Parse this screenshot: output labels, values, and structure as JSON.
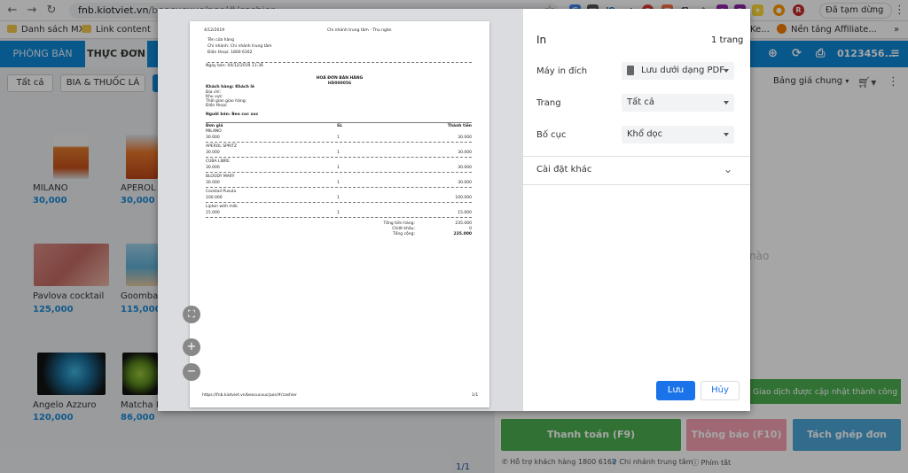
{
  "browser": {
    "url_host": "fnb.kiotviet.vn",
    "url_path": "/beocucxuc/pos/#/cashier",
    "pause_label": "Đã tạm dừng",
    "bookmarks": [
      "Danh sách MXH",
      "Link content",
      "Ke...",
      "Nền tảng Affiliate..."
    ]
  },
  "app": {
    "tabs": [
      "PHÒNG BÀN",
      "THỰC ĐƠN"
    ],
    "phone": "0123456...",
    "categories": [
      "Tất cả",
      "BIA & THUỐC LÁ"
    ],
    "price_list": "Bảng giá chung",
    "products": [
      {
        "name": "MILANO",
        "price": "30,000"
      },
      {
        "name": "APEROL S",
        "price": "30,000"
      },
      {
        "name": "Pavlova cocktail",
        "price": "125,000"
      },
      {
        "name": "Goombay",
        "price": "115,000"
      },
      {
        "name": "Angelo Azzuro",
        "price": "120,000"
      },
      {
        "name": "Matcha Ha",
        "price": "86,000"
      }
    ],
    "empty_hint": "nào",
    "toast": "Giao dịch được cập nhật thành công",
    "buttons": {
      "pay": "Thanh toán (F9)",
      "notify": "Thông báo (F10)",
      "split": "Tách ghép đơn"
    },
    "footer": {
      "support": "Hỗ trợ khách hàng 1800 6162",
      "branch": "Chi nhánh trung tâm",
      "shortcuts": "Phím tắt"
    },
    "pager": "1/1",
    "colors": {
      "brand": "#0e87d6",
      "pay": "#4caf50",
      "notify": "#f4a0b0",
      "split": "#4ca6d9",
      "price": "#1d8ad6"
    }
  },
  "print": {
    "title": "In",
    "pages": "1 trang",
    "destination_label": "Máy in đích",
    "destination_value": "Lưu dưới dạng PDF",
    "pages_label": "Trang",
    "pages_value": "Tất cả",
    "layout_label": "Bố cục",
    "layout_value": "Khổ dọc",
    "more_label": "Cài đặt khác",
    "save": "Lưu",
    "cancel": "Hủy"
  },
  "receipt": {
    "date": "4/12/2019",
    "header_center": "Chi nhánh trung tâm - Thu ngân",
    "store_name": "Tên cửa hàng",
    "branch": "Chi nhánh: Chi nhánh trung tâm",
    "phone": "Điện thoại: 1800 6162",
    "sale_date": "Ngày bán: 04/12/2019 11:36",
    "title": "HOÁ ĐƠN BÁN HÀNG",
    "code": "HD000056",
    "customer": "Khách hàng: Khách lẻ",
    "address": "Địa chỉ:",
    "area": "Khu vực:",
    "delivery": "Thời gian giao hàng:",
    "cust_phone": "Điện thoại:",
    "seller": "Người bán: Beo cuc xuc",
    "col_price": "Đơn giá",
    "col_qty": "SL",
    "col_total": "Thành tiền",
    "items": [
      {
        "name": "MILANO",
        "price": "30.000",
        "qty": "1",
        "total": "30.000"
      },
      {
        "name": "APEROL SPRITZ",
        "price": "30.000",
        "qty": "1",
        "total": "30.000"
      },
      {
        "name": "CUBA LIBRE",
        "price": "30.000",
        "qty": "1",
        "total": "30.000"
      },
      {
        "name": "BLOODY MARY",
        "price": "30.000",
        "qty": "1",
        "total": "30.000"
      },
      {
        "name": "Cocktail Pusula",
        "price": "100.000",
        "qty": "1",
        "total": "100.000"
      },
      {
        "name": "Lipton with milk",
        "price": "15.000",
        "qty": "1",
        "total": "15.000"
      }
    ],
    "sum_label": "Tổng tiền hàng:",
    "sum_value": "235.000",
    "discount_label": "Chiết khấu:",
    "discount_value": "0",
    "grand_label": "Tổng cộng:",
    "grand_value": "235.000",
    "footer_url": "https://fnb.kiotviet.vn/beocucxuc/pos/#/cashier",
    "footer_page": "1/1"
  }
}
